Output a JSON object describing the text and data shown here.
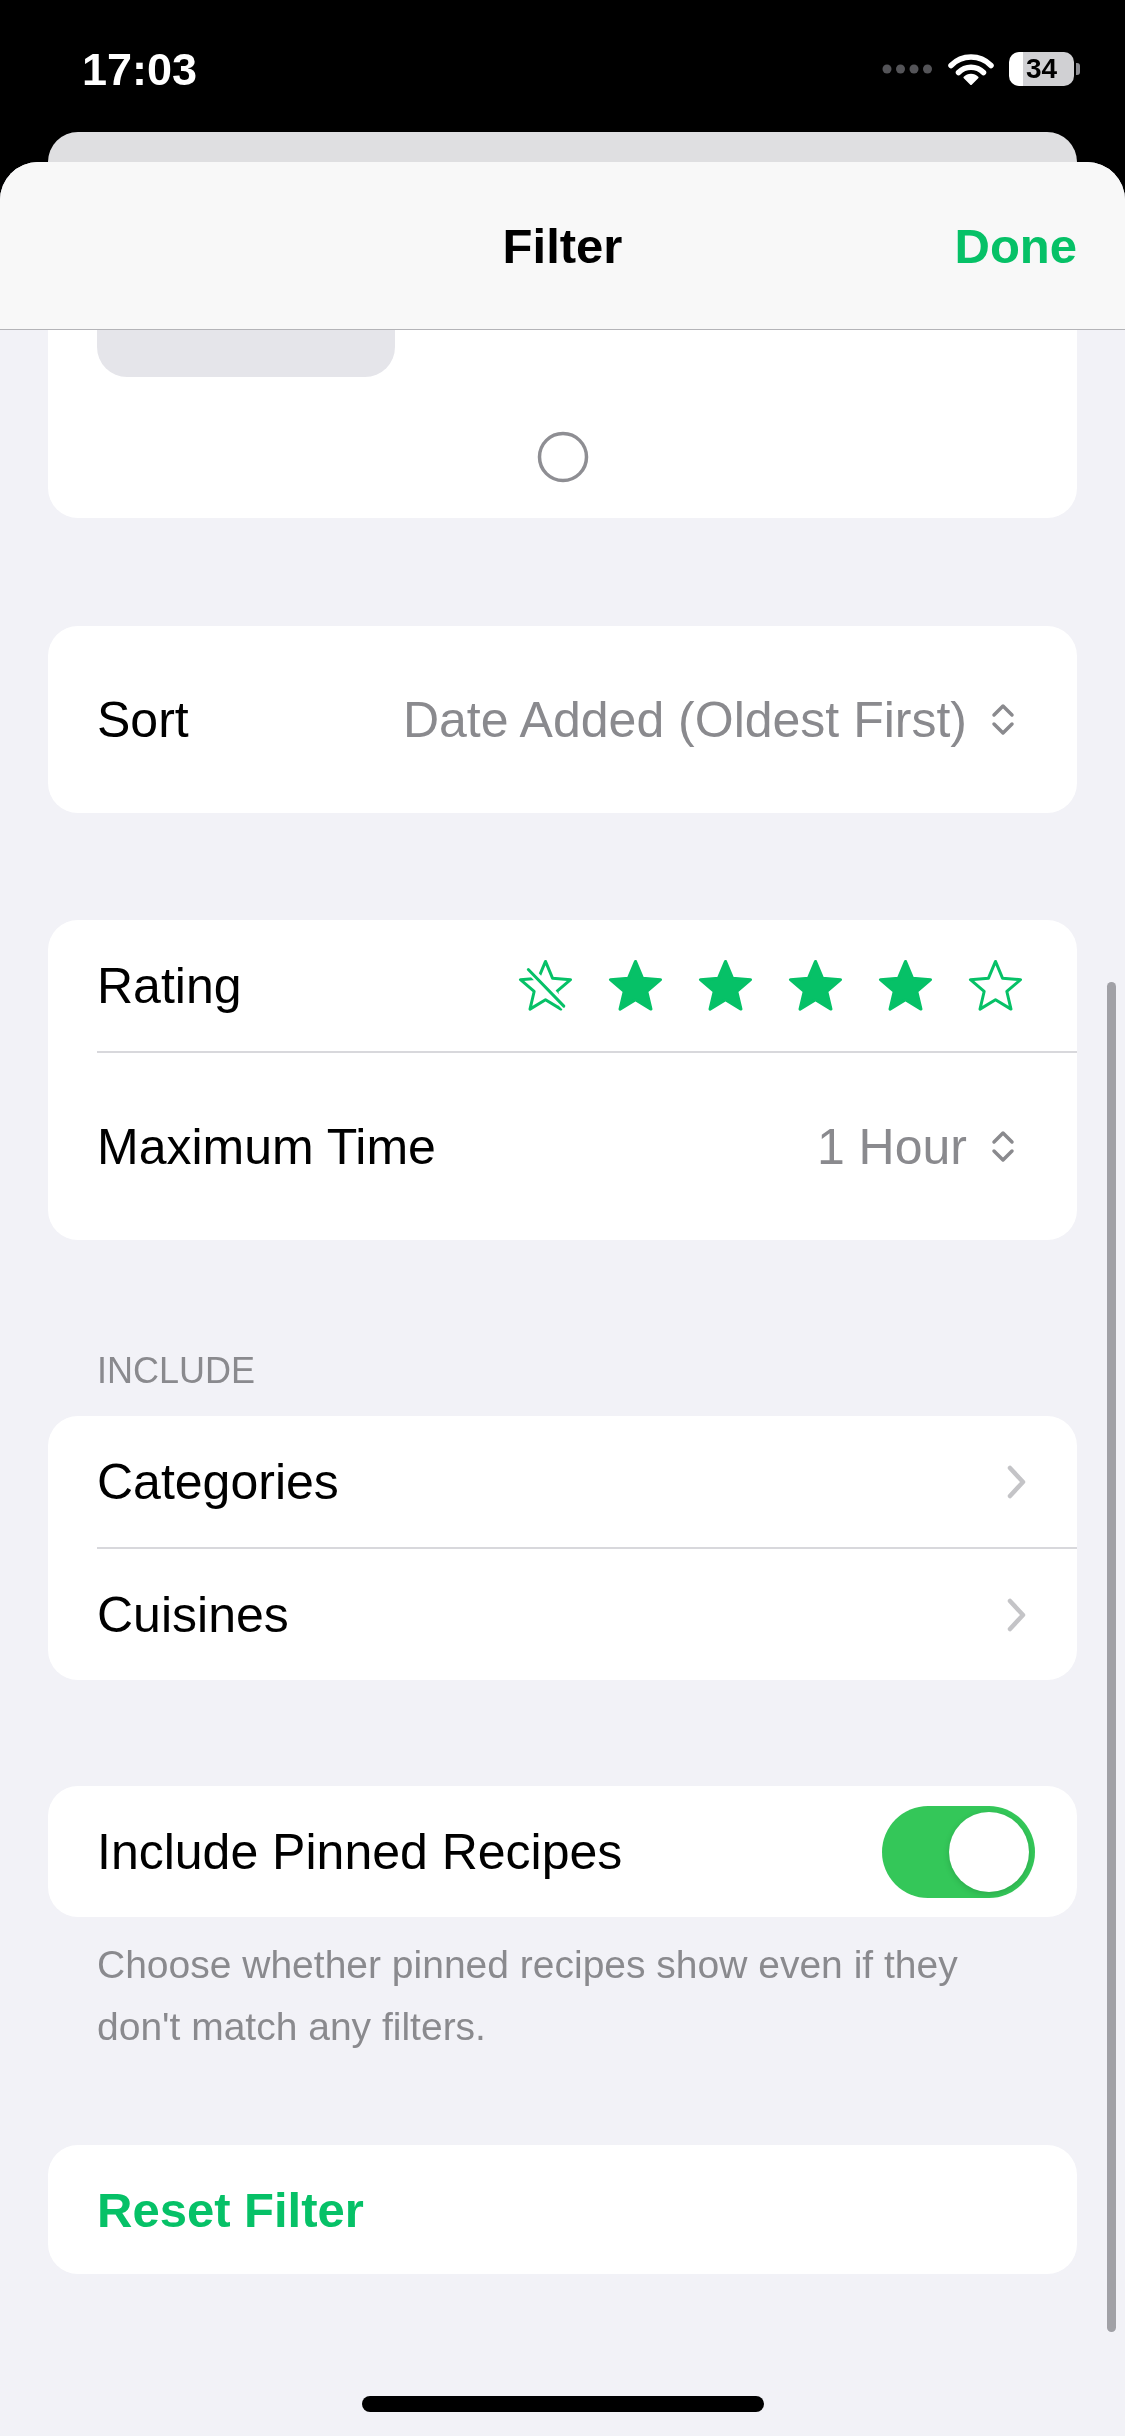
{
  "status_bar": {
    "time": "17:03",
    "battery": "34"
  },
  "navigation": {
    "title": "Filter",
    "done": "Done"
  },
  "sort": {
    "label": "Sort",
    "value": "Date Added (Oldest First)"
  },
  "filters": [
    {
      "kind": "rating",
      "label": "Rating",
      "stars": 4
    },
    {
      "kind": "picker",
      "label": "Maximum Time",
      "value": "1 Hour"
    }
  ],
  "include": {
    "header": "INCLUDE",
    "items": [
      {
        "label": "Categories"
      },
      {
        "label": "Cuisines"
      }
    ]
  },
  "pinned": {
    "label": "Include Pinned Recipes",
    "on": true,
    "footer": "Choose whether pinned recipes show even if they don't match any filters."
  },
  "reset": {
    "label": "Reset Filter"
  }
}
